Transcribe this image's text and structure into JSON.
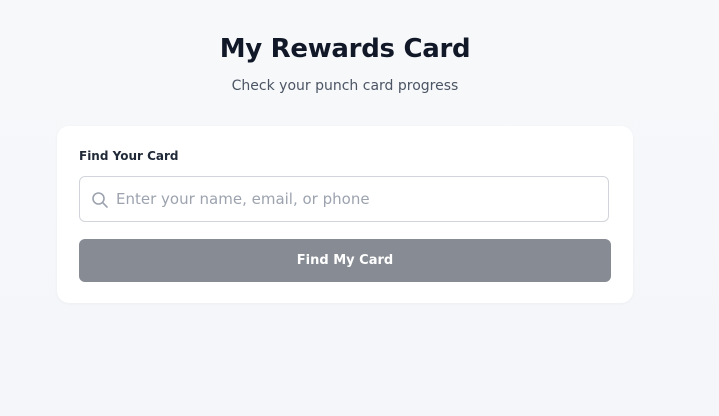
{
  "header": {
    "title": "My Rewards Card",
    "subtitle": "Check your punch card progress"
  },
  "lookup": {
    "label": "Find Your Card",
    "search": {
      "value": "",
      "placeholder": "Enter your name, email, or phone",
      "icon": "search-icon"
    },
    "button_label": "Find My Card",
    "button_color": "#878b93"
  },
  "colors": {
    "background": "#f5f6f8",
    "card": "#ffffff",
    "title": "#111827",
    "subtitle": "#4b5563"
  }
}
